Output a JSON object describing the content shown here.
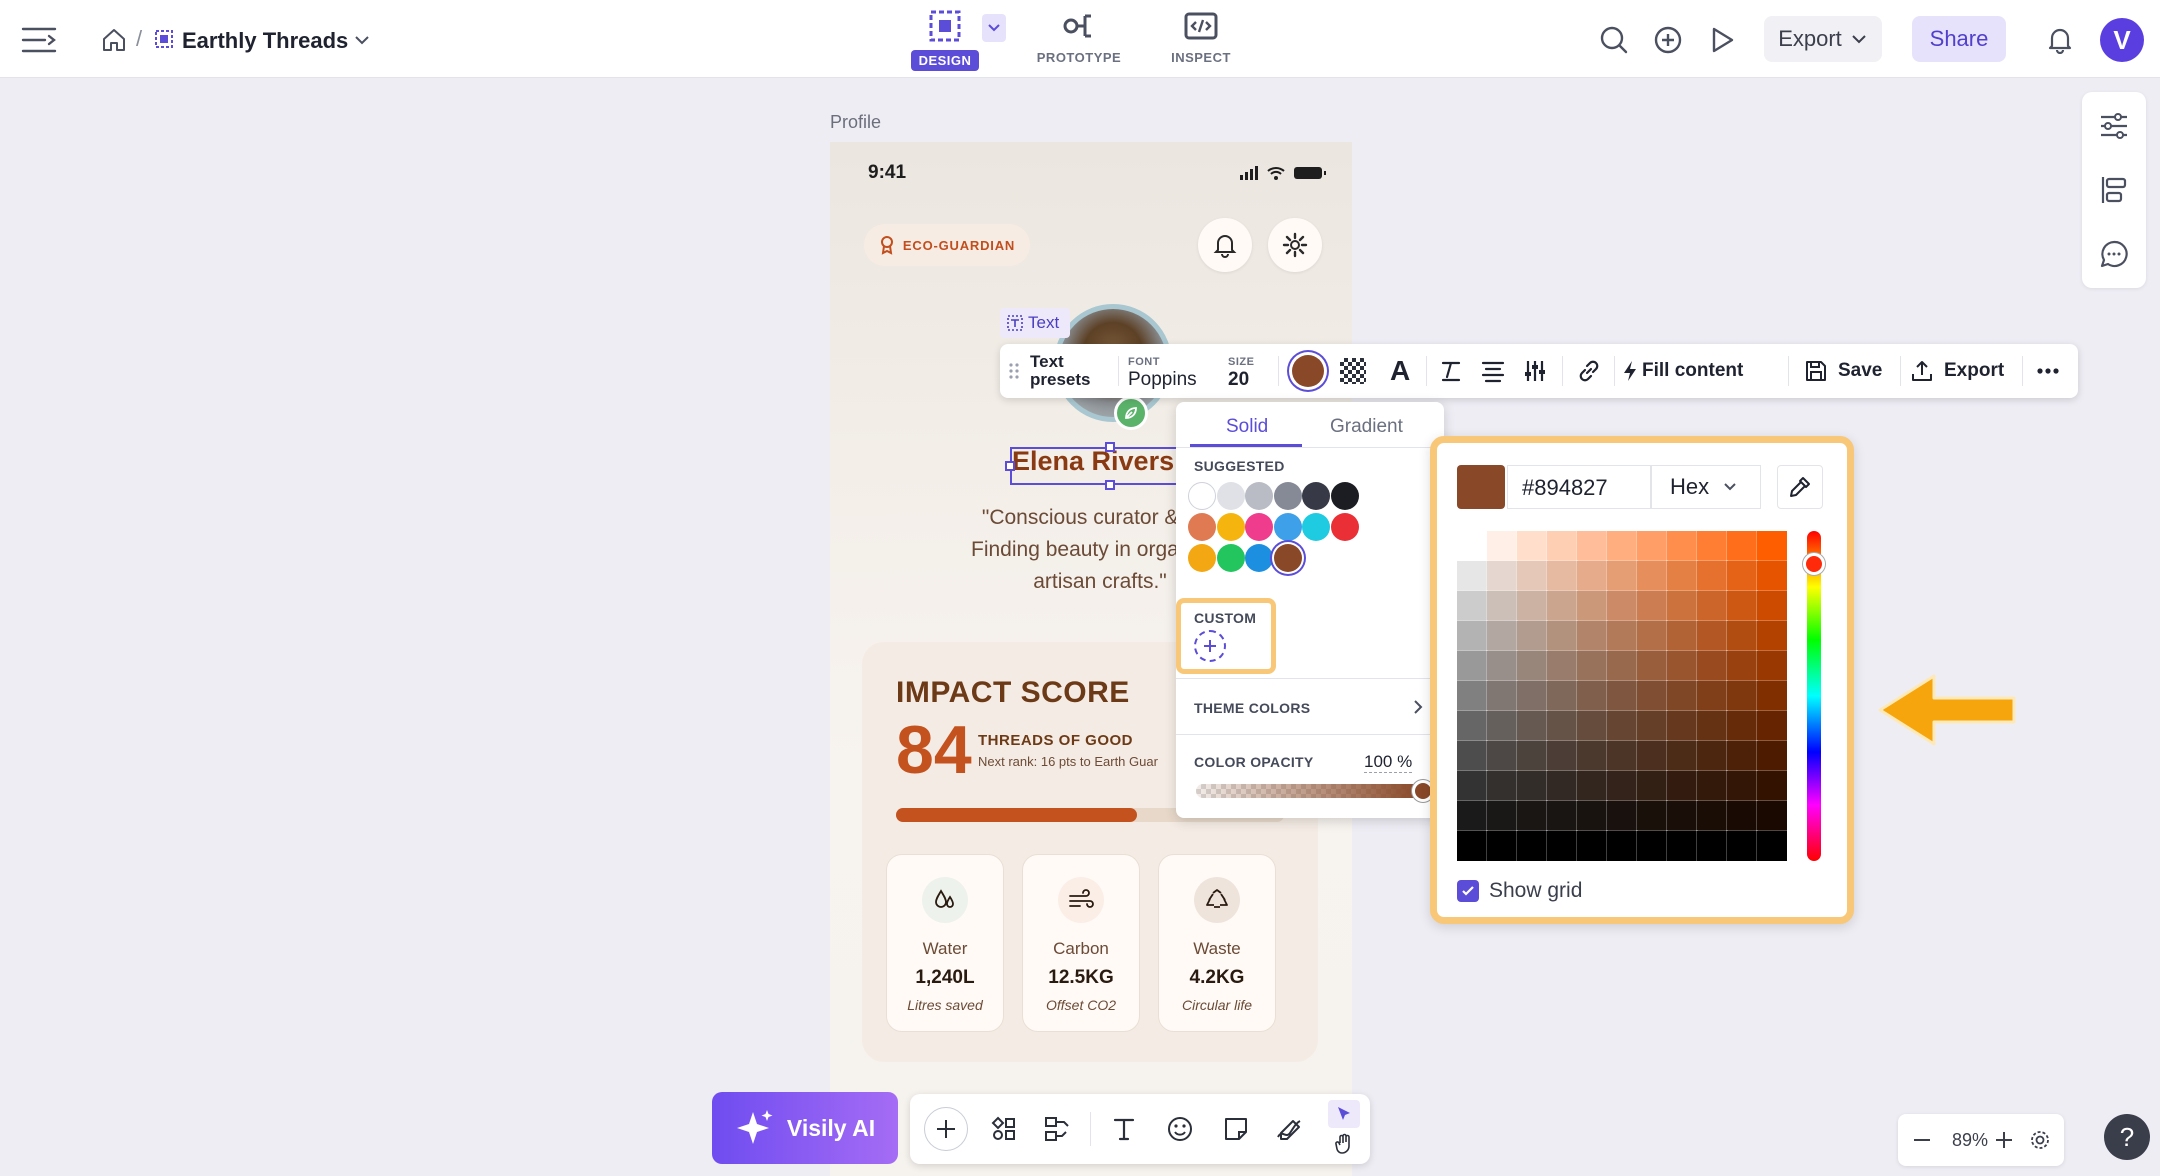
{
  "header": {
    "project_name": "Earthly Threads",
    "tabs": [
      {
        "label": "DESIGN",
        "active": true
      },
      {
        "label": "PROTOTYPE",
        "active": false
      },
      {
        "label": "INSPECT",
        "active": false
      }
    ],
    "export_label": "Export",
    "share_label": "Share",
    "avatar_letter": "V"
  },
  "canvas": {
    "frame_label": "Profile",
    "phone": {
      "time": "9:41",
      "badge": "ECO-GUARDIAN",
      "name": "Elena Rivers",
      "bio_lines": [
        "\"Conscious curator & text",
        "Finding beauty in organic th",
        "artisan crafts.\""
      ],
      "impact": {
        "title": "IMPACT SCORE",
        "score": "84",
        "threads_label": "THREADS OF GOOD",
        "rank_text": "Next rank: 16 pts to Earth Guar",
        "progress": 0.62
      },
      "stats": [
        {
          "name": "Water",
          "value": "1,240L",
          "sub": "Litres saved",
          "icon": "water-drops-icon"
        },
        {
          "name": "Carbon",
          "value": "12.5KG",
          "sub": "Offset CO2",
          "icon": "wind-icon"
        },
        {
          "name": "Waste",
          "value": "4.2KG",
          "sub": "Circular life",
          "icon": "recycle-icon"
        }
      ]
    }
  },
  "text_tag": "Text",
  "toolbar": {
    "presets_line1": "Text",
    "presets_line2": "presets",
    "font_label": "FONT",
    "font_value": "Poppins",
    "size_label": "SIZE",
    "size_value": "20",
    "fill_content": "Fill content",
    "save": "Save",
    "export": "Export"
  },
  "color_popover": {
    "tab_solid": "Solid",
    "tab_gradient": "Gradient",
    "suggested_label": "SUGGESTED",
    "suggested_colors": [
      [
        "#ffffff",
        "#dfe1e6",
        "#b9bcc4",
        "#868a96",
        "#373a46",
        "#1c1d22"
      ],
      [
        "#e07a52",
        "#f6b40e",
        "#f03c8c",
        "#3ea0e8",
        "#1ecbe1",
        "#eb2f36"
      ],
      [
        "#f3a712",
        "#22c55e",
        "#1d8fe0",
        "#894827"
      ]
    ],
    "custom_label": "CUSTOM",
    "theme_colors_label": "THEME COLORS",
    "opacity_label": "COLOR OPACITY",
    "opacity_value": "100",
    "opacity_unit": "%"
  },
  "picker": {
    "hex_value": "#894827",
    "format": "Hex",
    "show_grid_label": "Show grid",
    "show_grid": true,
    "current_color": "#894827"
  },
  "bottom": {
    "visily_ai": "Visily AI",
    "zoom_value": "89%",
    "help": "?"
  }
}
